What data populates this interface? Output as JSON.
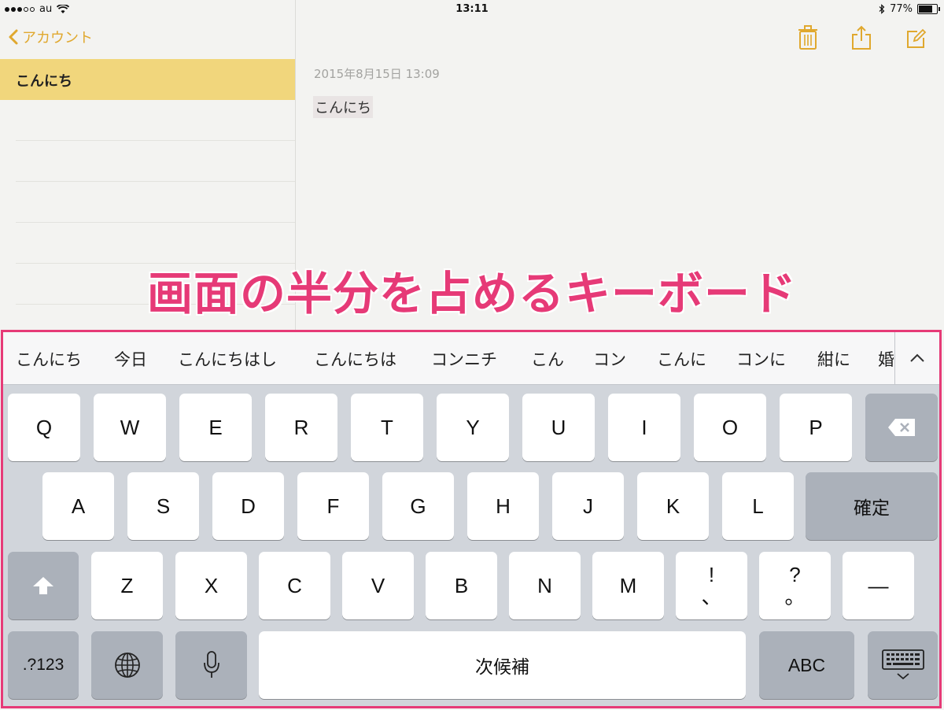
{
  "status_bar": {
    "carrier": "au",
    "time": "13:11",
    "battery": "77%",
    "battery_level": 0.77
  },
  "sidebar": {
    "back_label": "アカウント",
    "notes": [
      {
        "title": "こんにち",
        "selected": true
      }
    ]
  },
  "note": {
    "date": "2015年8月15日 13:09",
    "body": "こんにち"
  },
  "toolbar": {
    "icons": [
      "trash-icon",
      "share-icon",
      "compose-icon"
    ],
    "accent": "#e0a82e"
  },
  "caption": "画面の半分を占めるキーボード",
  "keyboard": {
    "candidates": [
      "こんにち",
      "今日",
      "こんにちはし",
      "こんにちは",
      "コンニチ",
      "こん",
      "コン",
      "こんに",
      "コンに",
      "紺に",
      "婚"
    ],
    "row1": [
      "Q",
      "W",
      "E",
      "R",
      "T",
      "Y",
      "U",
      "I",
      "O",
      "P"
    ],
    "row2": [
      "A",
      "S",
      "D",
      "F",
      "G",
      "H",
      "J",
      "K",
      "L"
    ],
    "row3": [
      "Z",
      "X",
      "C",
      "V",
      "B",
      "N",
      "M"
    ],
    "punct1": {
      "top": "!",
      "bottom": "、"
    },
    "punct2": {
      "top": "?",
      "bottom": "。"
    },
    "dash": "—",
    "confirm": "確定",
    "numbers": ".?123",
    "space": "次候補",
    "abc": "ABC",
    "highlight_color": "#e63a77"
  }
}
